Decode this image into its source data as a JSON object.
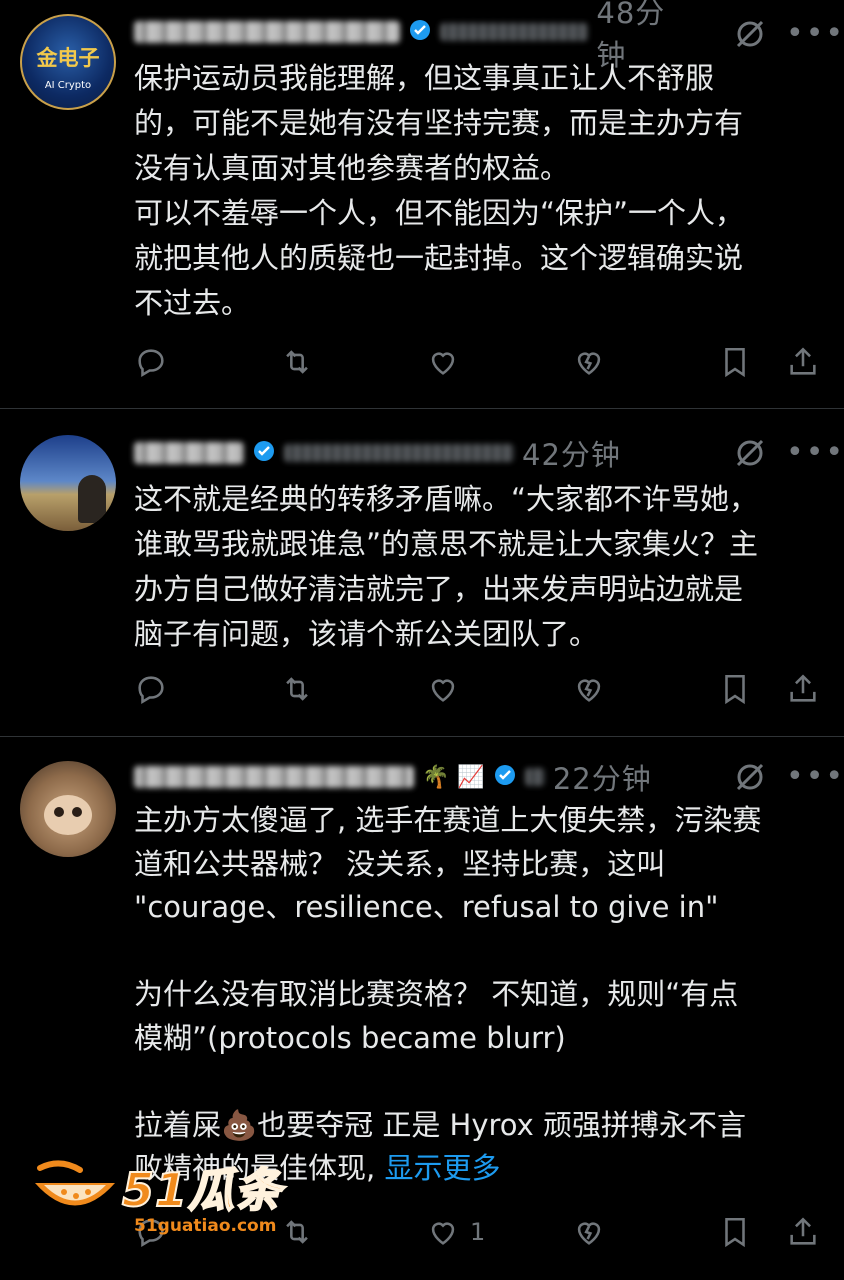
{
  "tweets": [
    {
      "time": "48分钟",
      "avatar_label": "金电子",
      "avatar_sub": "AI Crypto",
      "text": "保护运动员我能理解，但这事真正让人不舒服\n的，可能不是她有没有坚持完赛，而是主办方有\n没有认真面对其他参赛者的权益。\n可以不羞辱一个人，但不能因为“保护”一个人，\n就把其他人的质疑也一起封掉。这个逻辑确实说\n不过去。",
      "show_more": "",
      "like_count": ""
    },
    {
      "time": "42分钟",
      "text": "这不就是经典的转移矛盾嘛。“大家都不许骂她，\n谁敢骂我就跟谁急”的意思不就是让大家集火？主\n办方自己做好清洁就完了，出来发声明站边就是\n脑子有问题，该请个新公关团队了。",
      "show_more": "",
      "like_count": ""
    },
    {
      "time": "22分钟",
      "name_emoji": "🌴",
      "name_emoji2": "📈",
      "text": "主办方太傻逼了, 选手在赛道上大便失禁，污染赛\n道和公共器械？ 没关系，坚持比赛，这叫\n\"courage、resilience、refusal to give in\"\n\n为什么没有取消比赛资格？ 不知道，规则“有点\n模糊”(protocols became blurr)\n\n拉着屎💩也要夺冠 正是 Hyrox 顽强拼搏永不言\n败精神的最佳体现, ",
      "show_more": "显示更多",
      "like_count": "1"
    }
  ],
  "watermark": {
    "brand": "51瓜条",
    "url": "51guatiao.com"
  },
  "colors": {
    "background": "#000000",
    "text": "#e7e9ea",
    "muted": "#71767b",
    "link": "#1d9bf0",
    "divider": "#2f3336",
    "verified": "#1d9bf0"
  },
  "icons": [
    "reply-icon",
    "retweet-icon",
    "like-icon",
    "grok-icon",
    "bookmark-icon",
    "share-icon",
    "more-icon"
  ]
}
